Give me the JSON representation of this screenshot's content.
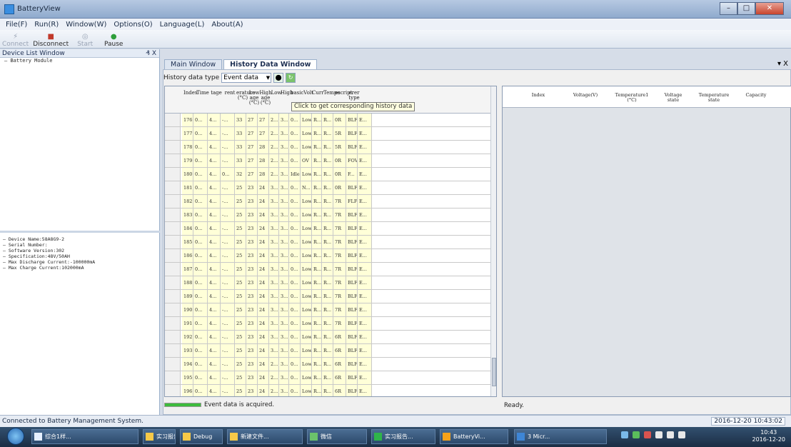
{
  "window": {
    "title": "BatteryView"
  },
  "menu": [
    "File(F)",
    "Run(R)",
    "Window(W)",
    "Options(O)",
    "Language(L)",
    "About(A)"
  ],
  "toolbar": {
    "connect": "Connect",
    "disconnect": "Disconnect",
    "start": "Start",
    "pause": "Pause"
  },
  "device_panel": {
    "title": "Device List Window",
    "pin": "₰ X",
    "tree": [
      "Battery Module"
    ],
    "info": [
      "Device Name:58A8G9-2",
      "Serial Number:",
      "Software Version:302",
      "Specification:48V/50AH",
      "Max Discharge Current:-100000mA",
      "Max Charge Current:102000mA"
    ]
  },
  "tabs": [
    {
      "label": "Main Window",
      "active": false
    },
    {
      "label": "History Data Window",
      "active": true
    }
  ],
  "tab_close": "▾ X",
  "history": {
    "type_label": "History data type",
    "type_value": "Event data",
    "tooltip": "Click to get corresponding history data",
    "columns": [
      "Index",
      "Time",
      "tage",
      "rent",
      "erature (°C)",
      "Low age (°C)",
      "High age (°C)",
      "Low",
      "High",
      "basic",
      "Volt",
      "Curr",
      "Tempe",
      "escript",
      "erer type"
    ],
    "rows": [
      [
        "176",
        "0...",
        "4...",
        "-...",
        "33",
        "27",
        "27",
        "2...",
        "3...",
        "0...",
        "Low",
        "R...",
        "R...",
        "0R",
        "BLF",
        "E..."
      ],
      [
        "177",
        "0...",
        "4...",
        "-...",
        "33",
        "27",
        "27",
        "2...",
        "3...",
        "0...",
        "Low",
        "R...",
        "R...",
        "5R",
        "BLF",
        "E..."
      ],
      [
        "178",
        "0...",
        "4...",
        "-...",
        "33",
        "27",
        "28",
        "2...",
        "3...",
        "0...",
        "Low",
        "R...",
        "R...",
        "5R",
        "BLF",
        "E..."
      ],
      [
        "179",
        "0...",
        "4...",
        "-...",
        "33",
        "27",
        "28",
        "2...",
        "3...",
        "0...",
        "OV",
        "R...",
        "R...",
        "0R",
        "FOV",
        "E..."
      ],
      [
        "180",
        "0...",
        "4...",
        "0...",
        "32",
        "27",
        "28",
        "2...",
        "3...",
        "Idle",
        "Low",
        "R...",
        "R...",
        "0R",
        "F...",
        "E..."
      ],
      [
        "181",
        "0...",
        "4...",
        "-...",
        "25",
        "23",
        "24",
        "3...",
        "3...",
        "0...",
        "N...",
        "R...",
        "R...",
        "0R",
        "BLF",
        "E..."
      ],
      [
        "182",
        "0...",
        "4...",
        "-...",
        "25",
        "23",
        "24",
        "3...",
        "3...",
        "0...",
        "Low",
        "R...",
        "R...",
        "7R",
        "FLF",
        "E..."
      ],
      [
        "183",
        "0...",
        "4...",
        "-...",
        "25",
        "23",
        "24",
        "3...",
        "3...",
        "0...",
        "Low",
        "R...",
        "R...",
        "7R",
        "BLF",
        "E..."
      ],
      [
        "184",
        "0...",
        "4...",
        "-...",
        "25",
        "23",
        "24",
        "3...",
        "3...",
        "0...",
        "Low",
        "R...",
        "R...",
        "7R",
        "BLF",
        "E..."
      ],
      [
        "185",
        "0...",
        "4...",
        "-...",
        "25",
        "23",
        "24",
        "3...",
        "3...",
        "0...",
        "Low",
        "R...",
        "R...",
        "7R",
        "BLF",
        "E..."
      ],
      [
        "186",
        "0...",
        "4...",
        "-...",
        "25",
        "23",
        "24",
        "3...",
        "3...",
        "0...",
        "Low",
        "R...",
        "R...",
        "7R",
        "BLF",
        "E..."
      ],
      [
        "187",
        "0...",
        "4...",
        "-...",
        "25",
        "23",
        "24",
        "3...",
        "3...",
        "0...",
        "Low",
        "R...",
        "R...",
        "7R",
        "BLF",
        "E..."
      ],
      [
        "188",
        "0...",
        "4...",
        "-...",
        "25",
        "23",
        "24",
        "3...",
        "3...",
        "0...",
        "Low",
        "R...",
        "R...",
        "7R",
        "BLF",
        "E..."
      ],
      [
        "189",
        "0...",
        "4...",
        "-...",
        "25",
        "23",
        "24",
        "3...",
        "3...",
        "0...",
        "Low",
        "R...",
        "R...",
        "7R",
        "BLF",
        "E..."
      ],
      [
        "190",
        "0...",
        "4...",
        "-...",
        "25",
        "23",
        "24",
        "3...",
        "3...",
        "0...",
        "Low",
        "R...",
        "R...",
        "7R",
        "BLF",
        "E..."
      ],
      [
        "191",
        "0...",
        "4...",
        "-...",
        "25",
        "23",
        "24",
        "3...",
        "3...",
        "0...",
        "Low",
        "R...",
        "R...",
        "7R",
        "BLF",
        "E..."
      ],
      [
        "192",
        "0...",
        "4...",
        "-...",
        "25",
        "23",
        "24",
        "3...",
        "3...",
        "0...",
        "Low",
        "R...",
        "R...",
        "6R",
        "BLF",
        "E..."
      ],
      [
        "193",
        "0...",
        "4...",
        "-...",
        "25",
        "23",
        "24",
        "3...",
        "3...",
        "0...",
        "Low",
        "R...",
        "R...",
        "6R",
        "BLF",
        "E..."
      ],
      [
        "194",
        "0...",
        "4...",
        "-...",
        "25",
        "23",
        "24",
        "2...",
        "3...",
        "0...",
        "Low",
        "R...",
        "R...",
        "6R",
        "BLF",
        "E..."
      ],
      [
        "195",
        "0...",
        "4...",
        "-...",
        "25",
        "23",
        "24",
        "2...",
        "3...",
        "0...",
        "Low",
        "R...",
        "R...",
        "6R",
        "BLF",
        "E..."
      ],
      [
        "196",
        "0...",
        "4...",
        "-...",
        "25",
        "23",
        "24",
        "2...",
        "3...",
        "0...",
        "Low",
        "R...",
        "R...",
        "6R",
        "BLF",
        "E..."
      ]
    ]
  },
  "detail": {
    "columns": [
      "Index",
      "Voltage(V)",
      "Temperature1 (°C)",
      "Voltage state",
      "Temperature state",
      "Capacity"
    ]
  },
  "progress": {
    "fraction": 1.0,
    "color": "#3dbb3d",
    "message": "Event data is acquired."
  },
  "right_status": "Ready.",
  "status": {
    "text": "Connected to Battery Management System.",
    "datetime": "2016-12-20 10:43:02"
  },
  "taskbar": {
    "items": [
      "综合1样...",
      "实习报告",
      "Debug",
      "新建文件...",
      "微信",
      "实习报告...",
      "BatteryVi...",
      "3 Micr..."
    ],
    "time": "10:43",
    "date": "2016-12-20"
  }
}
